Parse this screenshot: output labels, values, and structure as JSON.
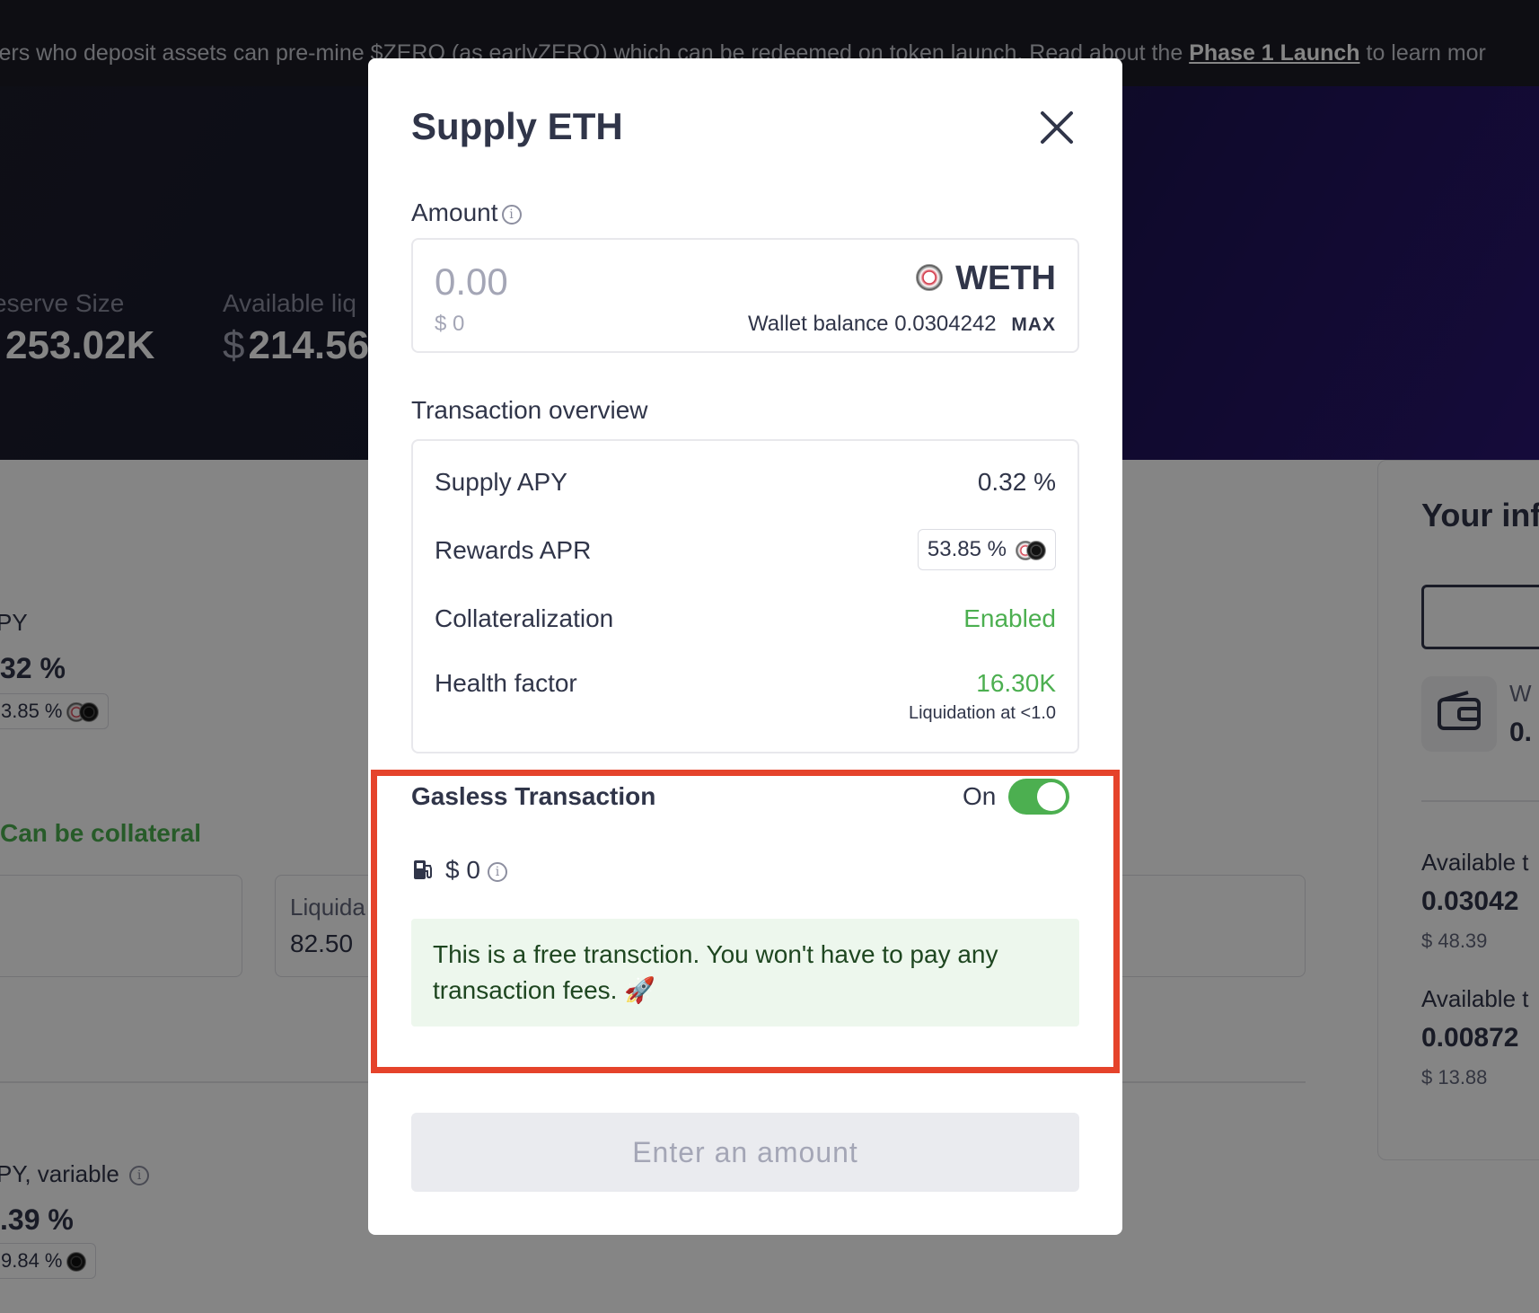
{
  "banner": {
    "text_before": "sers who deposit assets can pre-mine $ZERO (as earlyZERO) which can be redeemed on token launch. Read about the ",
    "link": "Phase 1 Launch",
    "text_after": " to learn mor"
  },
  "background": {
    "reserve_size_label": "eserve Size",
    "reserve_size_value": "253.02K",
    "available_liq_label": "Available liq",
    "available_liq_currency": "$",
    "available_liq_value": "214.56",
    "apy_label": "PY",
    "apy_value": "32 %",
    "apy_rewards": "3.85 %",
    "collateral_text": "Can be collateral",
    "liquidation_label": "Liquida",
    "liquidation_value": "82.50",
    "borrow_apy_label": "PY, variable",
    "borrow_apy_value": ".39 %",
    "borrow_rewards": "9.84 %",
    "side_title": "Your inf",
    "side_wallet_label": "W",
    "side_wallet_value": "0.",
    "side_available1_label": "Available t",
    "side_available1_value": "0.03042",
    "side_available1_usd": "$ 48.39",
    "side_available2_label": "Available t",
    "side_available2_value": "0.00872",
    "side_available2_usd": "$ 13.88"
  },
  "modal": {
    "title": "Supply ETH",
    "amount_label": "Amount",
    "amount_placeholder": "0.00",
    "amount_usd": "$ 0",
    "token": "WETH",
    "wallet_balance_label": "Wallet balance",
    "wallet_balance_value": "0.0304242",
    "max_label": "MAX",
    "overview_label": "Transaction overview",
    "overview": {
      "supply_apy_label": "Supply APY",
      "supply_apy_value": "0.32 %",
      "rewards_apr_label": "Rewards APR",
      "rewards_apr_value": "53.85 %",
      "collateralization_label": "Collateralization",
      "collateralization_value": "Enabled",
      "health_factor_label": "Health factor",
      "health_factor_value": "16.30K",
      "liquidation_note": "Liquidation at <1.0"
    },
    "gasless": {
      "title": "Gasless Transaction",
      "toggle_label": "On",
      "toggle_on": true,
      "gas_cost": "$ 0",
      "note": "This is a free transction. You won't have to pay any transaction fees. 🚀"
    },
    "submit_label": "Enter an amount"
  },
  "colors": {
    "accent_green": "#4caf50",
    "highlight_red": "#e5432b",
    "text_dark": "#303549"
  }
}
